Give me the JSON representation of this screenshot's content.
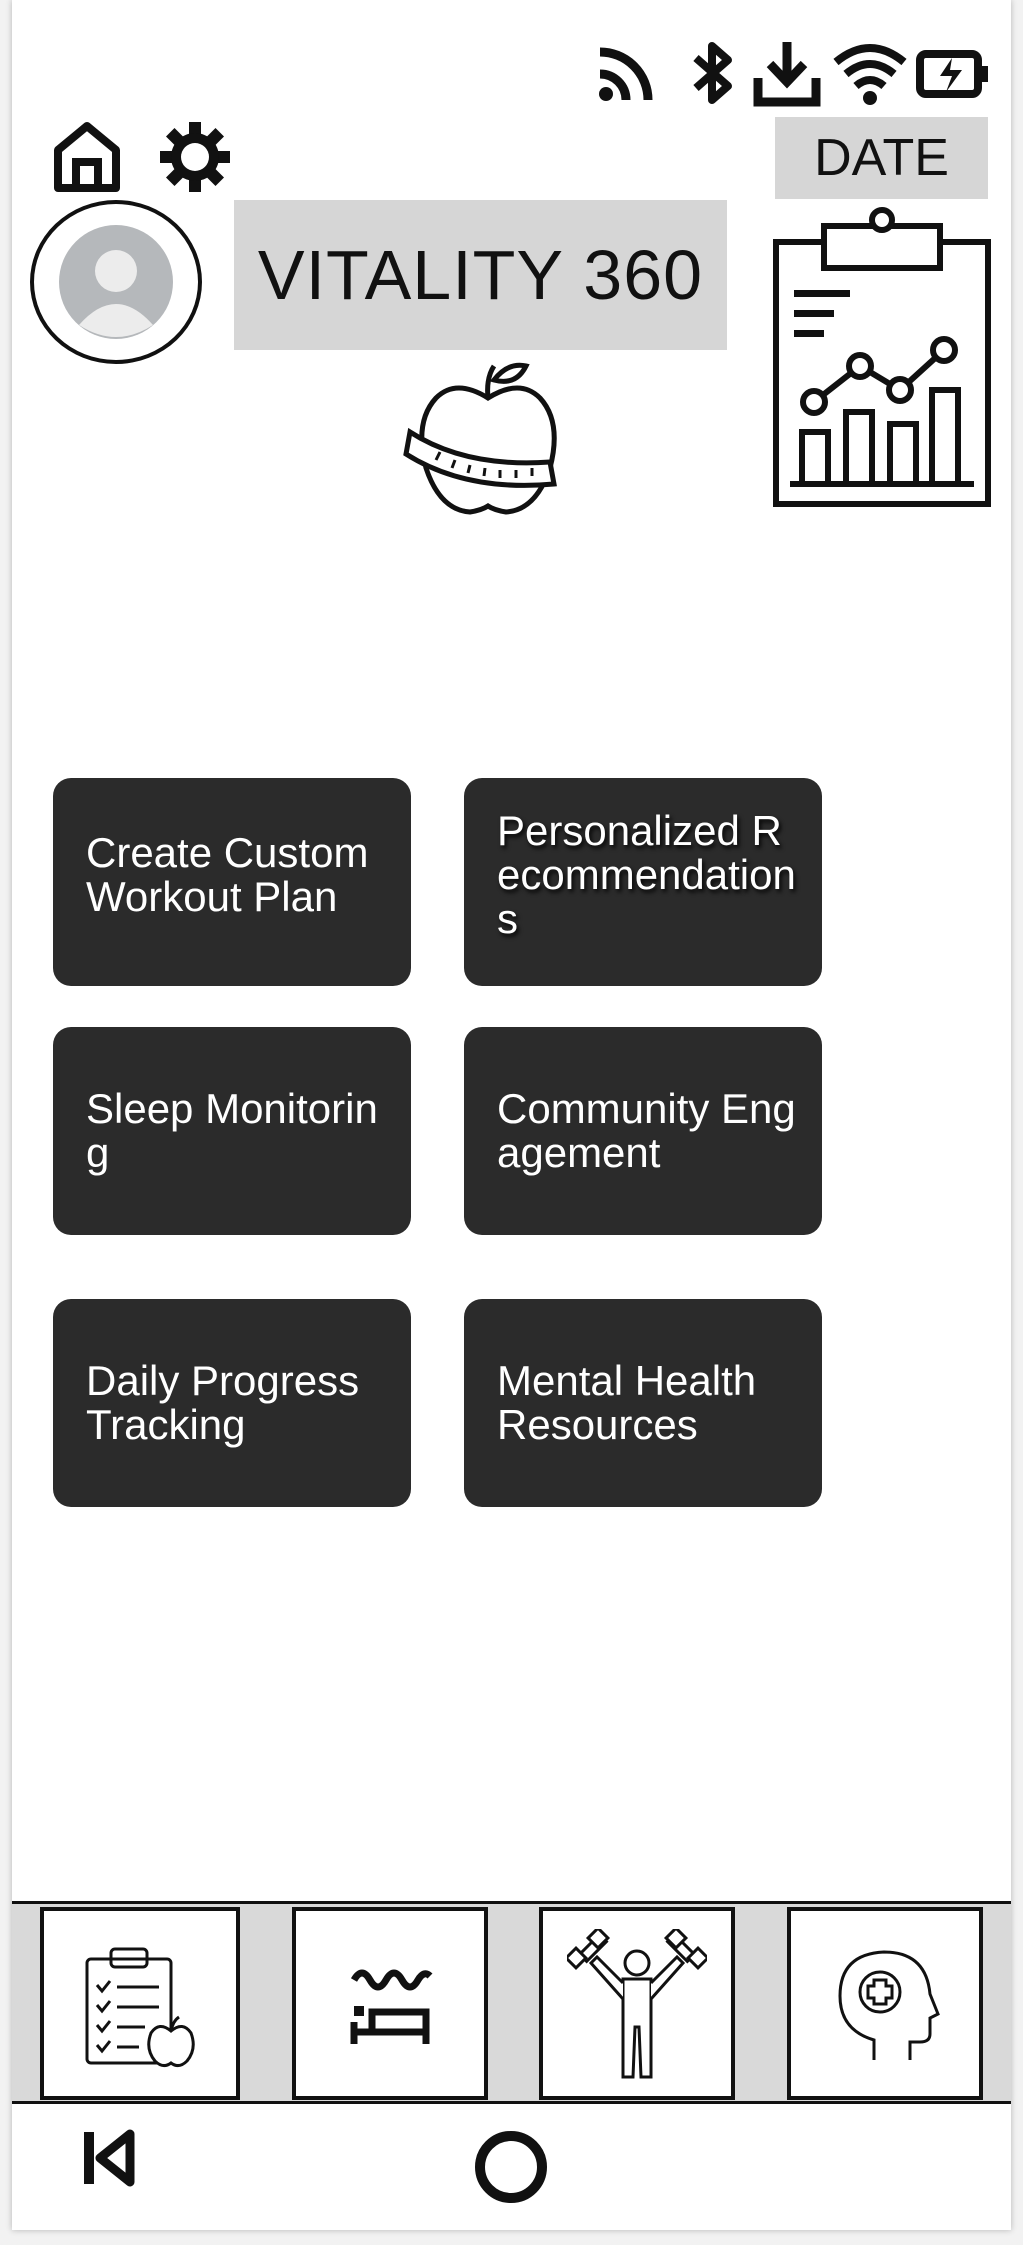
{
  "app": {
    "title": "VITALITY 360",
    "date_label": "DATE"
  },
  "status_bar": {
    "icons": [
      "cast-icon",
      "bluetooth-icon",
      "download-icon",
      "wifi-icon",
      "battery-charging-icon"
    ]
  },
  "header": {
    "icons": [
      "home-icon",
      "gear-icon",
      "avatar",
      "apple-measuring-tape-icon",
      "clipboard-chart-icon"
    ]
  },
  "tiles": [
    {
      "label": "Create Custom Workout Plan"
    },
    {
      "label": "Personalized Recommendations"
    },
    {
      "label": "Sleep Monitoring"
    },
    {
      "label": "Community Engagement"
    },
    {
      "label": "Daily Progress Tracking"
    },
    {
      "label": "Mental Health Resources"
    }
  ],
  "tab_bar": {
    "tabs": [
      {
        "icon": "checklist-apple-icon"
      },
      {
        "icon": "sleep-bed-icon"
      },
      {
        "icon": "fitness-dumbbell-icon"
      },
      {
        "icon": "mental-health-head-icon"
      }
    ]
  },
  "nav_bar": {
    "icons": [
      "back-icon",
      "home-circle-icon"
    ]
  },
  "colors": {
    "tile_background": "#2b2b2b",
    "label_box_background": "#d6d6d6",
    "tab_bar_background": "#d9d9d9"
  }
}
